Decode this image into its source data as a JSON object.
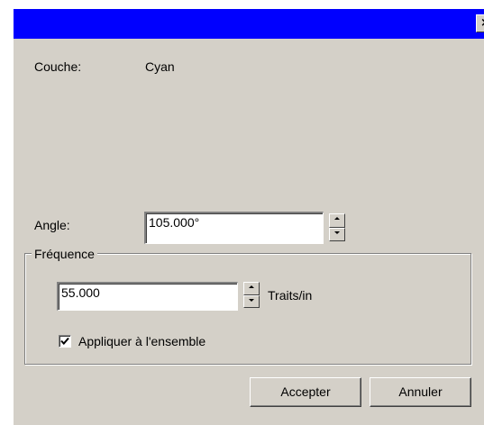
{
  "window": {
    "titlebar_color": "#0000ff",
    "close_glyph": "×"
  },
  "layer": {
    "label": "Couche:",
    "value": "Cyan"
  },
  "angle": {
    "label": "Angle:",
    "value": "105.000°"
  },
  "frequency": {
    "group_label": "Fréquence",
    "value": "55.000",
    "unit": "Traits/in"
  },
  "apply_all": {
    "label": "Appliquer à l'ensemble",
    "checked": true
  },
  "buttons": {
    "accept": "Accepter",
    "cancel": "Annuler"
  },
  "icons": {
    "close": "close-icon",
    "spin_up": "arrow-up-icon",
    "spin_down": "arrow-down-icon",
    "check": "checkmark-icon"
  }
}
